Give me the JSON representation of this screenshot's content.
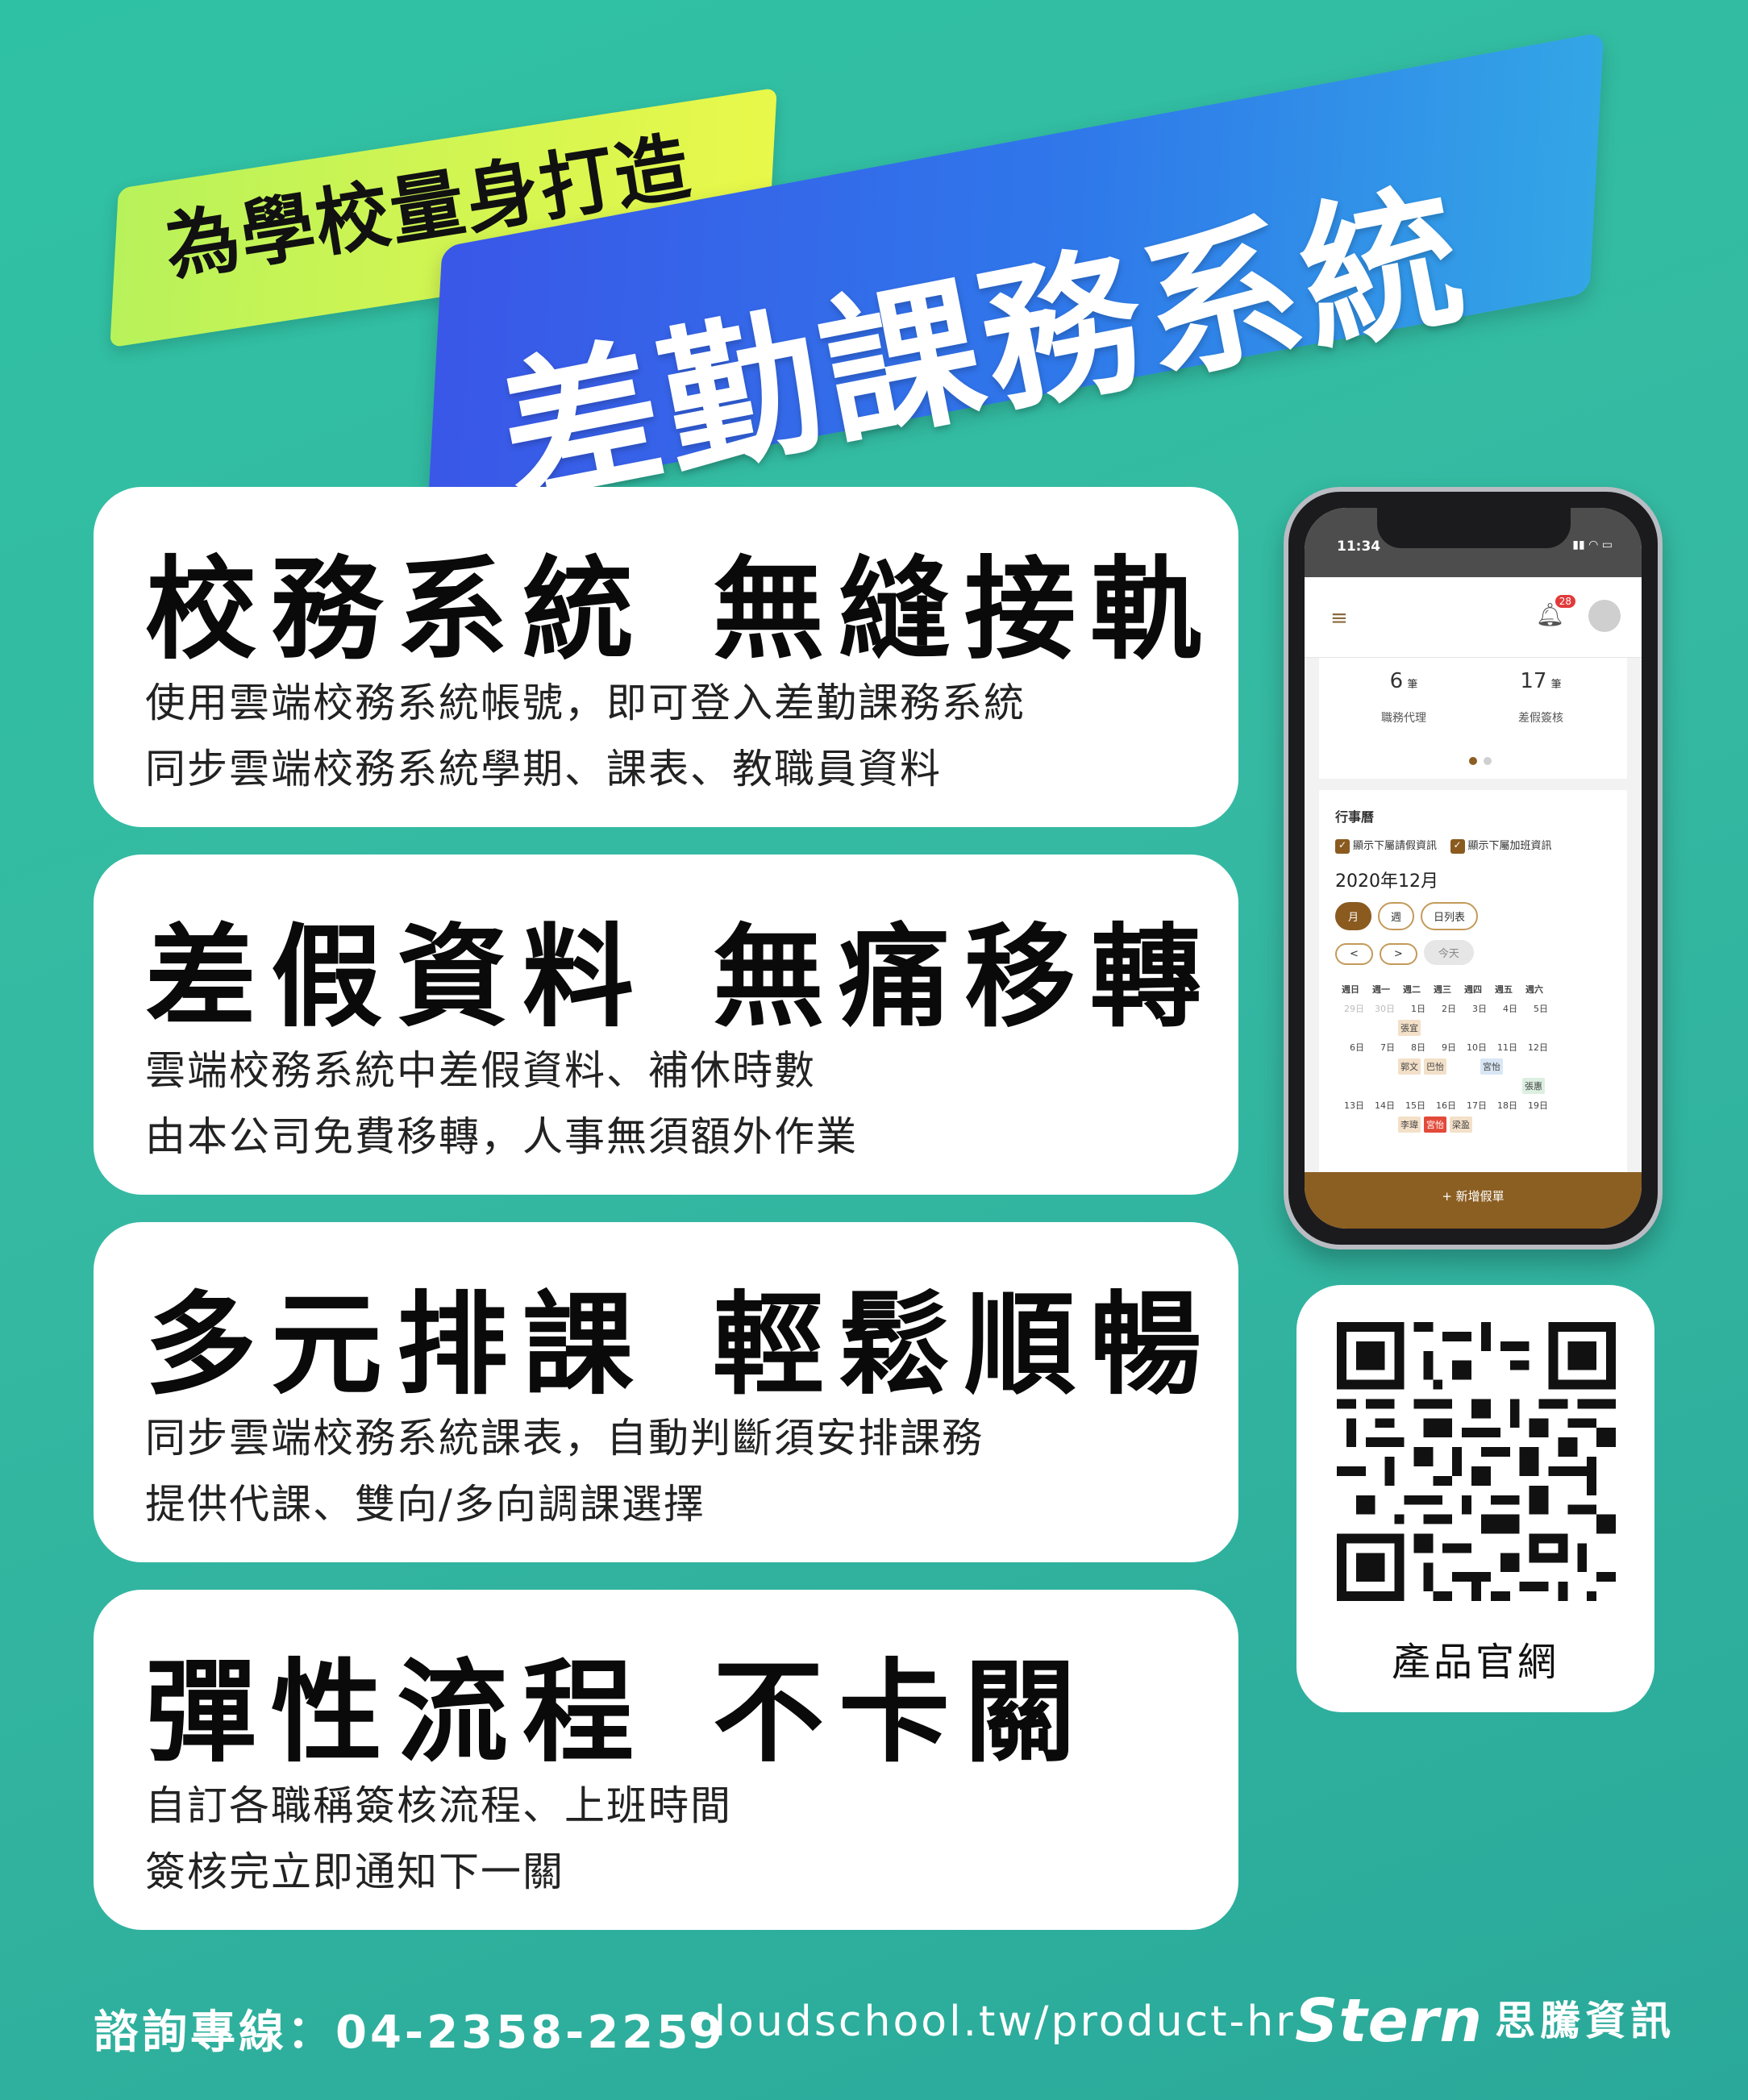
{
  "header": {
    "tagline": "為學校量身打造",
    "title": "差勤課務系統"
  },
  "cards": [
    {
      "title_a": "校務系統",
      "title_b": "無縫接軌",
      "line1": "使用雲端校務系統帳號，即可登入差勤課務系統",
      "line2": "同步雲端校務系統學期、課表、教職員資料"
    },
    {
      "title_a": "差假資料",
      "title_b": "無痛移轉",
      "line1": "雲端校務系統中差假資料、補休時數",
      "line2": "由本公司免費移轉，人事無須額外作業"
    },
    {
      "title_a": "多元排課",
      "title_b": "輕鬆順暢",
      "line1": "同步雲端校務系統課表，自動判斷須安排課務",
      "line2": "提供代課、雙向/多向調課選擇"
    },
    {
      "title_a": "彈性流程",
      "title_b": "不卡關",
      "line1": "自訂各職稱簽核流程、上班時間",
      "line2": "簽核完立即通知下一關"
    }
  ],
  "phone": {
    "time": "11:34",
    "badge": "28",
    "stat1_num": "6",
    "stat1_unit": "筆",
    "stat1_label": "職務代理",
    "stat2_num": "17",
    "stat2_unit": "筆",
    "stat2_label": "差假簽核",
    "calendar_title": "行事曆",
    "check1": "顯示下屬請假資訊",
    "check2": "顯示下屬加班資訊",
    "month": "2020年12月",
    "view_month": "月",
    "view_week": "週",
    "view_list": "日列表",
    "prev": "<",
    "next": ">",
    "today": "今天",
    "weekdays": [
      "週日",
      "週一",
      "週二",
      "週三",
      "週四",
      "週五",
      "週六"
    ],
    "week1": [
      "29日",
      "30日",
      "1日",
      "2日",
      "3日",
      "4日",
      "5日"
    ],
    "week2": [
      "6日",
      "7日",
      "8日",
      "9日",
      "10日",
      "11日",
      "12日"
    ],
    "week3": [
      "13日",
      "14日",
      "15日",
      "16日",
      "17日",
      "18日",
      "19日"
    ],
    "events_w1": [
      "張宜"
    ],
    "events_w2": [
      "郭文",
      "巴怡",
      "宮怡",
      "張惠"
    ],
    "events_w3": [
      "李瑋",
      "宮怡",
      "梁盈"
    ],
    "cta": "+ 新增假單"
  },
  "qr": {
    "label": "產品官網"
  },
  "footer": {
    "phone": "諮詢專線：04-2358-2259",
    "url": "cloudschool.tw/product-hr",
    "brand_logo": "Stern",
    "brand_name": "思騰資訊"
  },
  "colors": {
    "background": "#33b9a2",
    "banner_yellow": "#d8f64c",
    "banner_blue": "#3462e8",
    "phone_accent": "#8b5e22"
  }
}
